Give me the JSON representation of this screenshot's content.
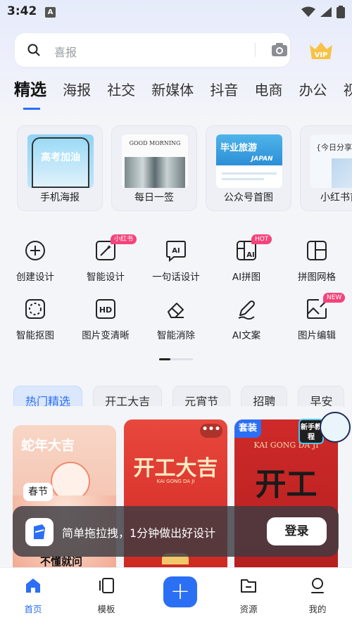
{
  "status": {
    "time": "3:42"
  },
  "search": {
    "placeholder": "喜报"
  },
  "categories": [
    "精选",
    "海报",
    "社交",
    "新媒体",
    "抖音",
    "电商",
    "办公",
    "视频"
  ],
  "cards": [
    {
      "label": "手机海报",
      "thumb_text": "高考加油"
    },
    {
      "label": "每日一签",
      "thumb_text": "GOOD MORNING"
    },
    {
      "label": "公众号首图",
      "thumb_text": "毕业旅游",
      "thumb_sub": "JAPAN"
    },
    {
      "label": "小红书首",
      "thumb_text": "{今日分享}"
    }
  ],
  "tools": [
    {
      "label": "创建设计",
      "icon": "plus-circle-icon"
    },
    {
      "label": "智能设计",
      "icon": "magic-wand-icon",
      "badge": "小红书"
    },
    {
      "label": "一句话设计",
      "icon": "ai-chat-icon"
    },
    {
      "label": "AI拼图",
      "icon": "ai-collage-icon",
      "badge": "HOT"
    },
    {
      "label": "拼图网格",
      "icon": "grid-icon"
    },
    {
      "label": "智能抠图",
      "icon": "cutout-icon"
    },
    {
      "label": "图片变清晰",
      "icon": "hd-icon"
    },
    {
      "label": "智能消除",
      "icon": "eraser-icon"
    },
    {
      "label": "AI文案",
      "icon": "pen-icon"
    },
    {
      "label": "图片编辑",
      "icon": "image-edit-icon",
      "badge": "NEW"
    }
  ],
  "tags": [
    "热门精选",
    "开工大吉",
    "元宵节",
    "招聘",
    "早安"
  ],
  "feed": {
    "card1_title": "蛇年大吉",
    "card1_tag": "春节",
    "card2_title": "开工大吉",
    "card2_sub": "KAI GONG DA JI",
    "card3_badge": "套装",
    "card3_title": "KAI GONG DA JI",
    "card3_big": "开工",
    "sticker": "新手教程"
  },
  "toast": {
    "message": "简单拖拉拽，1分钟做出好设计",
    "login": "登录"
  },
  "ask": "不懂就问",
  "tabs": [
    "首页",
    "模板",
    "资源",
    "我的"
  ],
  "colors": {
    "accent": "#2b6ff5",
    "badge": "#f5437b"
  }
}
